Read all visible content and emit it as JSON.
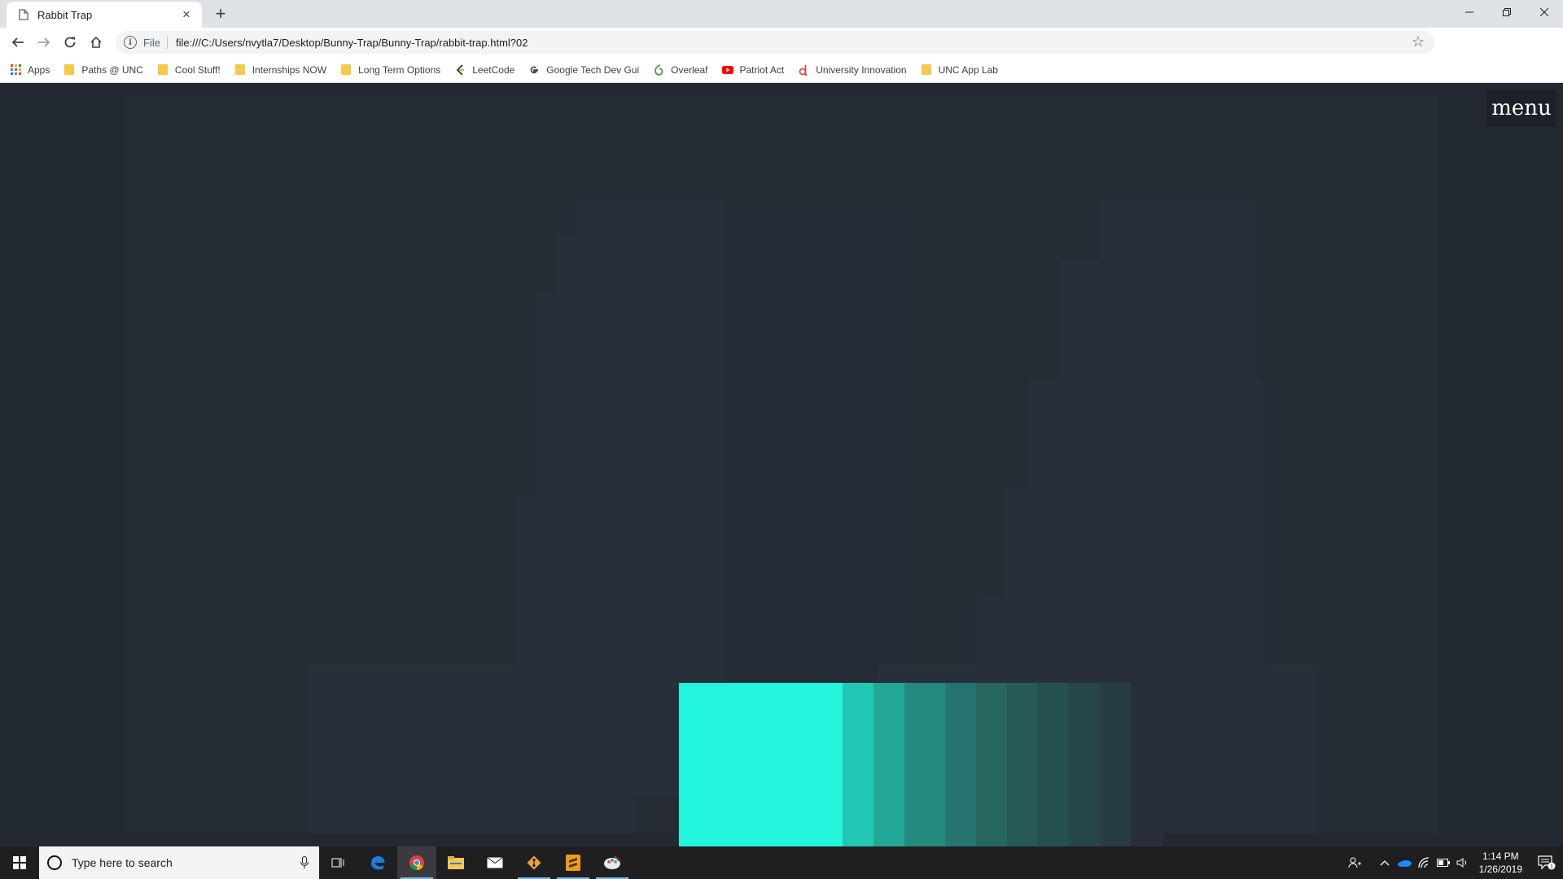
{
  "browser": {
    "tab_title": "Rabbit Trap",
    "tab_close": "×",
    "new_tab": "+",
    "omnibox": {
      "scheme": "File",
      "url": "file:///C:/Users/nvytla7/Desktop/Bunny-Trap/Bunny-Trap/rabbit-trap.html?02"
    },
    "bookmarks": [
      {
        "label": "Apps",
        "icon": "apps-grid-icon"
      },
      {
        "label": "Paths @ UNC",
        "icon": "folder-icon"
      },
      {
        "label": "Cool Stuff!",
        "icon": "folder-icon"
      },
      {
        "label": "Internships NOW",
        "icon": "folder-icon"
      },
      {
        "label": "Long Term Options",
        "icon": "folder-icon"
      },
      {
        "label": "LeetCode",
        "icon": "leetcode-icon"
      },
      {
        "label": "Google Tech Dev Gui",
        "icon": "google-icon"
      },
      {
        "label": "Overleaf",
        "icon": "overleaf-icon"
      },
      {
        "label": "Patriot Act",
        "icon": "youtube-icon"
      },
      {
        "label": "University Innovation",
        "icon": "d-logo-icon"
      },
      {
        "label": "UNC App Lab",
        "icon": "folder-icon"
      }
    ]
  },
  "page": {
    "menu_label": "menu",
    "glow_colors": [
      "#22f5dc",
      "#22c8b4",
      "#23a797",
      "#248a80",
      "#257470",
      "#26665f",
      "#265a56",
      "#264f50",
      "#274649",
      "#273d43",
      "#282f38"
    ]
  },
  "taskbar": {
    "search_placeholder": "Type here to search",
    "time": "1:14 PM",
    "date": "1/26/2019",
    "notification_count": "1"
  }
}
